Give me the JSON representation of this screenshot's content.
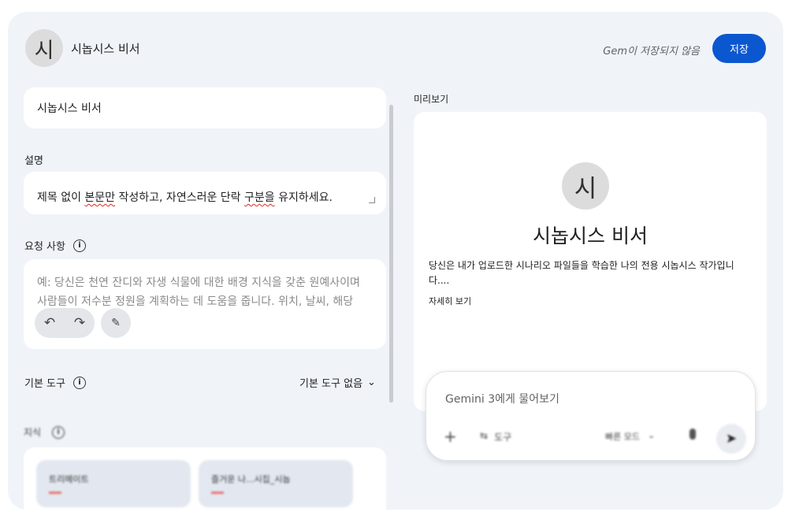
{
  "header": {
    "avatar_letter": "시",
    "gem_name": "시놉시스 비서",
    "status": "Gem이 저장되지 않음",
    "save_label": "저장"
  },
  "editor": {
    "name_value": "시놉시스 비서",
    "description_label": "설명",
    "description_value_part1": "제목 없이 ",
    "description_value_sq1": "본문만",
    "description_value_part2": " 작성하고, 자연스러운 단락 ",
    "description_value_sq2": "구분을",
    "description_value_part3": " 유지하세요.",
    "instructions_label": "요청 사항",
    "instructions_placeholder": "예: 당신은 천연 잔디와 자생 식물에 대한 배경 지식을 갖춘 원예사이며 사람들이 저수분 정원을 계획하는 데 도움을 줍니다. 위치, 날씨, 해당",
    "tools_label": "기본 도구",
    "tools_value": "기본 도구 없음",
    "knowledge_label": "지식",
    "knowledge_files": [
      {
        "name": "트리메이트"
      },
      {
        "name": "즐거운 나...시집_시놉"
      }
    ]
  },
  "preview": {
    "label": "미리보기",
    "avatar_letter": "시",
    "title": "시놉시스 비서",
    "description": "당신은 내가 업로드한 시나리오 파일들을 학습한 나의 전용 시놉시스 작가입니다....",
    "more_label": "자세히 보기"
  },
  "chat": {
    "placeholder": "Gemini 3에게 물어보기",
    "tools_label": "도구",
    "mode_label": "빠른 모드"
  },
  "colors": {
    "accent": "#0b57d0",
    "panel_bg": "#f0f4f9",
    "card_bg": "#ffffff"
  },
  "icons": {
    "info": "info-icon",
    "undo": "undo-icon",
    "redo": "redo-icon",
    "magic": "magic-wand-icon",
    "chevron": "chevron-down-icon",
    "plus": "plus-icon",
    "tools": "tools-icon",
    "mic": "mic-icon",
    "send": "send-icon"
  }
}
